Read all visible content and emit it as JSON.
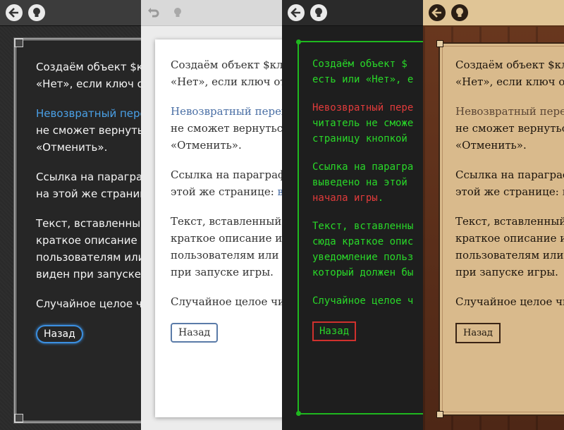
{
  "toolbar": {
    "back_icon": "back-arrow-icon",
    "hint_icon": "lightbulb-icon"
  },
  "text": {
    "line1a": "Создаём объект $клю",
    "line1b": "«Нет», если ключ от",
    "line2a": "Невозвратный перех",
    "line2b": "не сможет вернуться",
    "line2c": "«Отменить».",
    "line3a": "Ссылка на параграф",
    "line3b": "на этой же страниц",
    "line3b_light": "этой же странице: ",
    "line3b_light_link": "вы",
    "line4a": "Текст, вставленный",
    "line4b": "краткое описание иг",
    "line4c": "пользователям или л",
    "line4d": "виден при запуске и",
    "line4d_light": "при запуске игры.",
    "line5": "Случайное целое чи",
    "back_button": "Назад"
  },
  "terminal": {
    "l1": "Создаём объект $",
    "l2": "есть или «Нет», е",
    "l3": "Невозвратный пере",
    "l4": "читатель не сможе",
    "l5": "страницу кнопкой",
    "l6": "Ссылка на парагра",
    "l7": "выведено на этой",
    "l8": "начала игры",
    "l8_dot": ".",
    "l9": "Текст, вставленны",
    "l10": "сюда краткое опис",
    "l11": "уведомление польз",
    "l12": "который должен бы",
    "l13": "Случайное целое ч",
    "back_button": "Назад"
  },
  "parchment": {
    "l1": "Создаём объект $кл",
    "l2": "«Нет», если ключ о",
    "l3": "Невозвратный перех",
    "l4": "не сможет вернуться",
    "l5": "«Отменить».",
    "l6": "Ссылка на параграф",
    "l7a": "этой же странице: ",
    "l7b": "вы",
    "l8": "Текст, вставленный",
    "l9": "краткое описание иг",
    "l10": "пользователям или л",
    "l11": "при запуске игры.",
    "l12": "Случайное целое чи",
    "back_button": "Назад"
  },
  "colors": {
    "dark_link": "#4aa0e6",
    "light_link": "#4a6fa5",
    "terminal_green": "#29d929",
    "terminal_red": "#e23b3b"
  }
}
